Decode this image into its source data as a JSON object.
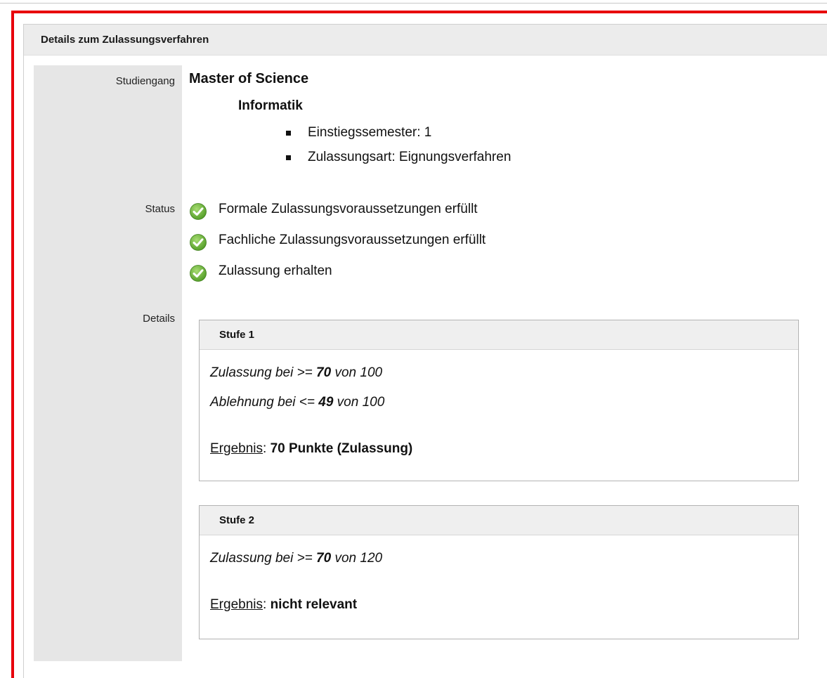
{
  "panel": {
    "title": "Details zum Zulassungsverfahren"
  },
  "labels": {
    "studiengang": "Studiengang",
    "status": "Status",
    "details": "Details"
  },
  "studiengang": {
    "degree": "Master of Science",
    "subject": "Informatik",
    "items": [
      "Einstiegssemester: 1",
      "Zulassungsart: Eignungsverfahren"
    ]
  },
  "status": {
    "items": [
      "Formale Zulassungsvoraussetzungen erfüllt",
      "Fachliche Zulassungsvoraussetzungen erfüllt",
      "Zulassung erhalten"
    ],
    "icon": "check-circle-icon",
    "icon_color": "#6cb23a"
  },
  "stages": [
    {
      "title": "Stufe 1",
      "criteria": [
        {
          "prefix": "Zulassung bei >= ",
          "value": "70",
          "suffix": " von 100"
        },
        {
          "prefix": "Ablehnung bei <= ",
          "value": "49",
          "suffix": " von 100"
        }
      ],
      "result_label": "Ergebnis",
      "result_sep": ": ",
      "result_value": "70 Punkte (Zulassung)"
    },
    {
      "title": "Stufe 2",
      "criteria": [
        {
          "prefix": "Zulassung bei >= ",
          "value": "70",
          "suffix": " von 120"
        }
      ],
      "result_label": "Ergebnis",
      "result_sep": ": ",
      "result_value": "nicht relevant"
    }
  ],
  "colors": {
    "frame": "#e8000b",
    "label_bg": "#e6e6e6",
    "header_bg": "#ececec"
  }
}
